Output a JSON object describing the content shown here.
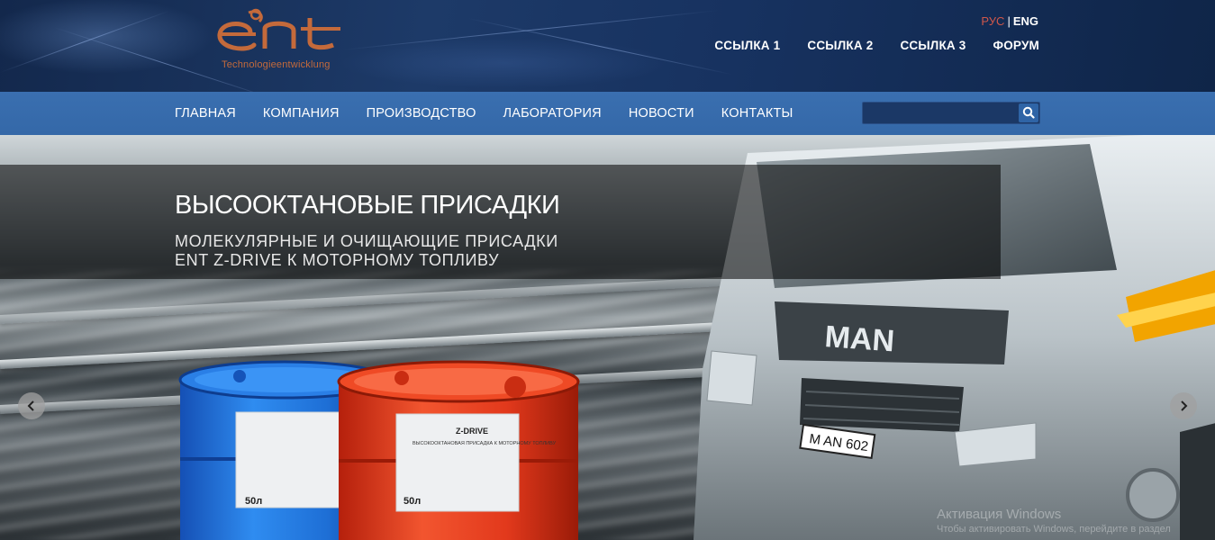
{
  "logo": {
    "brand": "ent",
    "tagline": "Technologieentwicklung"
  },
  "language": {
    "ru": "РУС",
    "separator": "|",
    "en": "ENG"
  },
  "top_links": [
    {
      "label": "ССЫЛКА 1"
    },
    {
      "label": "ССЫЛКА 2"
    },
    {
      "label": "ССЫЛКА 3"
    },
    {
      "label": "ФОРУМ"
    }
  ],
  "main_nav": [
    {
      "label": "ГЛАВНАЯ"
    },
    {
      "label": "КОМПАНИЯ"
    },
    {
      "label": "ПРОИЗВОДСТВО"
    },
    {
      "label": "ЛАБОРАТОРИЯ"
    },
    {
      "label": "НОВОСТИ"
    },
    {
      "label": "КОНТАКТЫ"
    }
  ],
  "search": {
    "placeholder": "",
    "value": "",
    "icon": "search-icon"
  },
  "hero": {
    "title": "ВЫСООКТАНОВЫЕ ПРИСАДКИ",
    "subtitle_line1": "МОЛЕКУЛЯРНЫЕ И ОЧИЩАЮЩИЕ ПРИСАДКИ",
    "subtitle_line2": "ENT Z-DRIVE К МОТОРНОМУ ТОПЛИВУ",
    "truck_brand": "MAN",
    "plate": "M AN 602",
    "barrel_label_title": "Z-DRIVE",
    "barrel_label_text": "ВЫСОКООКТАНОВАЯ ПРИСАДКА К МОТОРНОМУ ТОПЛИВУ",
    "barrel_volume": "50л",
    "prev_icon": "chevron-left-icon",
    "next_icon": "chevron-right-icon"
  },
  "watermark": {
    "line1": "Активация Windows",
    "line2": "Чтобы активировать Windows, перейдите в раздел"
  },
  "colors": {
    "nav_blue": "#3a6fb0",
    "header_navy": "#1d3a68",
    "logo_copper": "#c46a3b",
    "lang_active": "#d0574a",
    "barrel_blue": "#1e6fd6",
    "barrel_red": "#e2391c"
  }
}
